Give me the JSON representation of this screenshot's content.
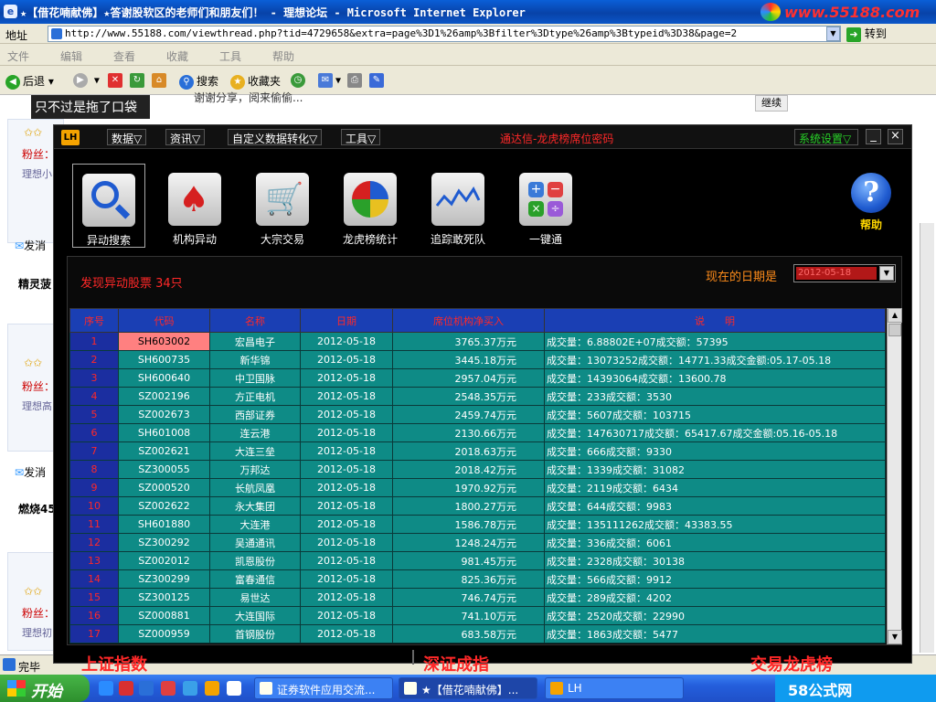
{
  "ie": {
    "title": "★【借花喃献佛】★答谢股软区的老师们和朋友们！ - 理想论坛 - Microsoft Internet Explorer",
    "brand": "www.55188.com",
    "address_label": "地址",
    "url": "http://www.55188.com/viewthread.php?tid=4729658&extra=page%3D1%26amp%3Bfilter%3Dtype%26amp%3Btypeid%3D38&page=2",
    "go_label": "转到",
    "menu": [
      "文件",
      "编辑",
      "查看",
      "收藏",
      "工具",
      "帮助"
    ],
    "toolbar": {
      "back": "后退",
      "search": "搜索",
      "favorites": "收藏夹"
    },
    "status": "完毕"
  },
  "background": {
    "caption": "只不过是拖了口袋",
    "visible_text": "谢谢分享，阅来偷偷...",
    "continue": "继续",
    "fans": "粉丝：",
    "links": [
      "理想小",
      "理想高",
      "理想初"
    ],
    "send": "发消",
    "names": [
      "精灵菠",
      "燃烧45"
    ]
  },
  "app": {
    "logo": "LH",
    "menus": [
      "数据▽",
      "资讯▽",
      "自定义数据转化▽",
      "工具▽"
    ],
    "title": "通达信-龙虎榜席位密码",
    "system": "系统设置▽",
    "min": "_",
    "close": "×",
    "tools": [
      {
        "label": "异动搜索",
        "icon": "magnifier-icon"
      },
      {
        "label": "机构异动",
        "icon": "spade-icon"
      },
      {
        "label": "大宗交易",
        "icon": "cart-icon"
      },
      {
        "label": "龙虎榜统计",
        "icon": "pie-chart-icon"
      },
      {
        "label": "追踪敢死队",
        "icon": "line-chart-icon"
      },
      {
        "label": "一键通",
        "icon": "calculator-icon"
      }
    ],
    "help": "帮助",
    "help_glyph": "?",
    "found": "发现异动股票 34只",
    "date_label": "现在的日期是",
    "date_value": "2012-05-18",
    "columns": [
      "序号",
      "代码",
      "名称",
      "日期",
      "席位机构净买入",
      "说　　明"
    ],
    "rows": [
      [
        "1",
        "SH603002",
        "宏昌电子",
        "2012-05-18",
        "3765.37万元",
        "成交量：6.88802E+07成交额：57395"
      ],
      [
        "2",
        "SH600735",
        "新华锦",
        "2012-05-18",
        "3445.18万元",
        "成交量：13073252成交额：14771.33成交金额:05.17-05.18"
      ],
      [
        "3",
        "SH600640",
        "中卫国脉",
        "2012-05-18",
        "2957.04万元",
        "成交量：14393064成交额：13600.78"
      ],
      [
        "4",
        "SZ002196",
        "方正电机",
        "2012-05-18",
        "2548.35万元",
        "成交量：233成交额：3530"
      ],
      [
        "5",
        "SZ002673",
        "西部证券",
        "2012-05-18",
        "2459.74万元",
        "成交量：5607成交额：103715"
      ],
      [
        "6",
        "SH601008",
        "连云港",
        "2012-05-18",
        "2130.66万元",
        "成交量：147630717成交额：65417.67成交金额:05.16-05.18"
      ],
      [
        "7",
        "SZ002621",
        "大连三垒",
        "2012-05-18",
        "2018.63万元",
        "成交量：666成交额：9330"
      ],
      [
        "8",
        "SZ300055",
        "万邦达",
        "2012-05-18",
        "2018.42万元",
        "成交量：1339成交额：31082"
      ],
      [
        "9",
        "SZ000520",
        "长航凤凰",
        "2012-05-18",
        "1970.92万元",
        "成交量：2119成交额：6434"
      ],
      [
        "10",
        "SZ002622",
        "永大集团",
        "2012-05-18",
        "1800.27万元",
        "成交量：644成交额：9983"
      ],
      [
        "11",
        "SH601880",
        "大连港",
        "2012-05-18",
        "1586.78万元",
        "成交量：135111262成交额：43383.55"
      ],
      [
        "12",
        "SZ300292",
        "吴通通讯",
        "2012-05-18",
        "1248.24万元",
        "成交量：336成交额：6061"
      ],
      [
        "13",
        "SZ002012",
        "凯恩股份",
        "2012-05-18",
        "981.45万元",
        "成交量：2328成交额：30138"
      ],
      [
        "14",
        "SZ300299",
        "富春通信",
        "2012-05-18",
        "825.36万元",
        "成交量：566成交额：9912"
      ],
      [
        "15",
        "SZ300125",
        "易世达",
        "2012-05-18",
        "746.74万元",
        "成交量：289成交额：4202"
      ],
      [
        "16",
        "SZ000881",
        "大连国际",
        "2012-05-18",
        "741.10万元",
        "成交量：2520成交额：22990"
      ],
      [
        "17",
        "SZ000959",
        "首钢股份",
        "2012-05-18",
        "683.58万元",
        "成交量：1863成交额：5477"
      ]
    ],
    "bottom_tabs": [
      "上证指数",
      "深证成指",
      "交易龙虎榜"
    ]
  },
  "taskbar": {
    "start": "开始",
    "tasks": [
      "证券软件应用交流...",
      "★【借花喃献佛】...",
      "LH"
    ],
    "tray": "58公式网"
  }
}
